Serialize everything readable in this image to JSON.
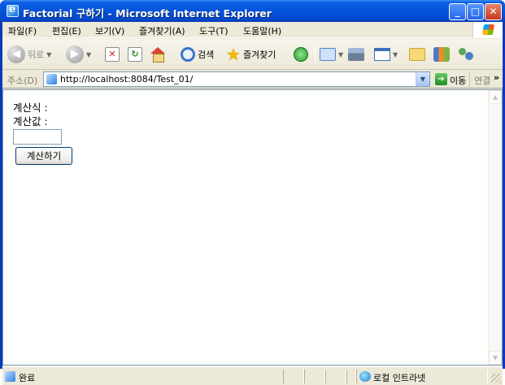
{
  "window": {
    "title": "Factorial 구하기 - Microsoft Internet Explorer",
    "minimize": "_",
    "maximize": "□",
    "close": "✕"
  },
  "menu": {
    "items": [
      {
        "label": "파일(F)"
      },
      {
        "label": "편집(E)"
      },
      {
        "label": "보기(V)"
      },
      {
        "label": "즐겨찾기(A)"
      },
      {
        "label": "도구(T)"
      },
      {
        "label": "도움말(H)"
      }
    ]
  },
  "toolbar": {
    "back_label": "뒤로",
    "search_label": "검색",
    "favorites_label": "즐겨찾기"
  },
  "address": {
    "label": "주소(D)",
    "url": "http://localhost:8084/Test_01/",
    "go_label": "이동",
    "links_label": "연결"
  },
  "page": {
    "expression_label": "계산식 :",
    "value_label": "계산값 :",
    "input_value": "",
    "button_label": "계산하기"
  },
  "status": {
    "text": "완료",
    "zone": "로컬 인트라넷"
  },
  "icons": [
    "ie-page-icon",
    "back-icon",
    "forward-icon",
    "stop-icon",
    "refresh-icon",
    "home-icon",
    "search-icon",
    "favorites-star-icon",
    "history-icon",
    "mail-icon",
    "print-icon",
    "edit-icon",
    "folder-icon",
    "messenger-icon",
    "people-icon",
    "go-arrow-icon",
    "intranet-zone-icon"
  ]
}
